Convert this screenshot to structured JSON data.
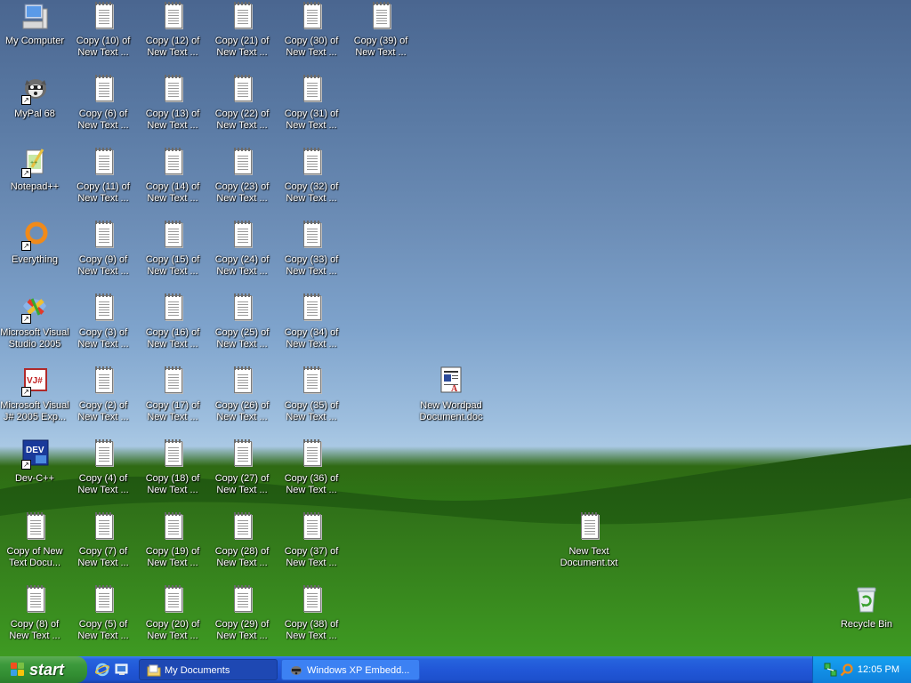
{
  "desktop": {
    "icons": {
      "my_computer": "My Computer",
      "mypal": "MyPal 68",
      "notepadpp": "Notepad++",
      "everything": "Everything",
      "msvs": "Microsoft Visual\nStudio 2005",
      "msvj": "Microsoft Visual\nJ# 2005 Exp...",
      "devcpp": "Dev-C++",
      "copy_of_new": "Copy of New\nText Docu...",
      "copy8": "Copy (8) of\nNew Text ...",
      "copy10": "Copy (10) of\nNew Text ...",
      "copy6": "Copy (6) of\nNew Text ...",
      "copy11": "Copy (11) of\nNew Text ...",
      "copy9": "Copy (9) of\nNew Text ...",
      "copy3": "Copy (3) of\nNew Text ...",
      "copy2": "Copy (2) of\nNew Text ...",
      "copy4": "Copy (4) of\nNew Text ...",
      "copy7": "Copy (7) of\nNew Text ...",
      "copy5": "Copy (5) of\nNew Text ...",
      "copy12": "Copy (12) of\nNew Text ...",
      "copy13": "Copy (13) of\nNew Text ...",
      "copy14": "Copy (14) of\nNew Text ...",
      "copy15": "Copy (15) of\nNew Text ...",
      "copy16": "Copy (16) of\nNew Text ...",
      "copy17": "Copy (17) of\nNew Text ...",
      "copy18": "Copy (18) of\nNew Text ...",
      "copy19": "Copy (19) of\nNew Text ...",
      "copy20": "Copy (20) of\nNew Text ...",
      "copy21": "Copy (21) of\nNew Text ...",
      "copy22": "Copy (22) of\nNew Text ...",
      "copy23": "Copy (23) of\nNew Text ...",
      "copy24": "Copy (24) of\nNew Text ...",
      "copy25": "Copy (25) of\nNew Text ...",
      "copy26": "Copy (26) of\nNew Text ...",
      "copy27": "Copy (27) of\nNew Text ...",
      "copy28": "Copy (28) of\nNew Text ...",
      "copy29": "Copy (29) of\nNew Text ...",
      "copy30": "Copy (30) of\nNew Text ...",
      "copy31": "Copy (31) of\nNew Text ...",
      "copy32": "Copy (32) of\nNew Text ...",
      "copy33": "Copy (33) of\nNew Text ...",
      "copy34": "Copy (34) of\nNew Text ...",
      "copy35": "Copy (35) of\nNew Text ...",
      "copy36": "Copy (36) of\nNew Text ...",
      "copy37": "Copy (37) of\nNew Text ...",
      "copy38": "Copy (38) of\nNew Text ...",
      "copy39": "Copy (39) of\nNew Text ...",
      "wordpad_doc": "New Wordpad\nDocument.doc",
      "new_text_doc": "New Text\nDocument.txt",
      "recycle_bin": "Recycle Bin"
    }
  },
  "taskbar": {
    "start_label": "start",
    "tasks": [
      "My Documents",
      "Windows XP Embedd..."
    ],
    "clock": "12:05 PM",
    "colors": {
      "taskbar": "#2157d7",
      "start": "#3c9a3c",
      "tray": "#1290e6"
    }
  }
}
